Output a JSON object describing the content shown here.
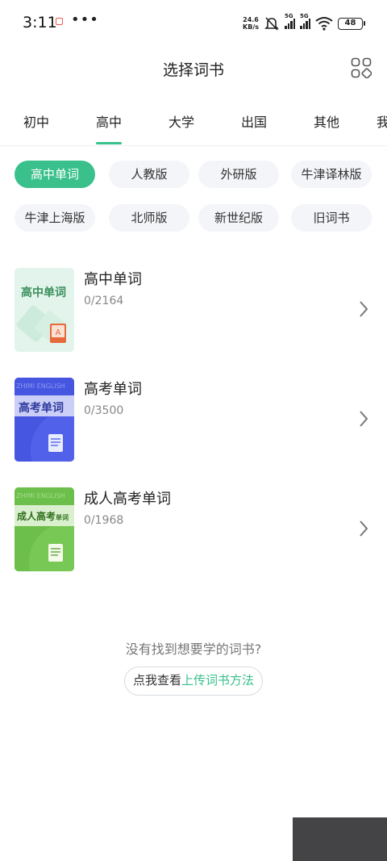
{
  "status_bar": {
    "time": "3:11",
    "dots": "•••",
    "net_speed_value": "24.6",
    "net_speed_unit": "KB/s",
    "sim1_label": "5G",
    "sim2_label": "5G",
    "battery": "48"
  },
  "header": {
    "title": "选择词书",
    "menu_icon": "grid-icon"
  },
  "tabs": [
    {
      "label": "初中",
      "active": false
    },
    {
      "label": "高中",
      "active": true
    },
    {
      "label": "大学",
      "active": false
    },
    {
      "label": "出国",
      "active": false
    },
    {
      "label": "其他",
      "active": false
    },
    {
      "label": "我",
      "active": false
    }
  ],
  "chips": [
    {
      "label": "高中单词",
      "active": true
    },
    {
      "label": "人教版",
      "active": false
    },
    {
      "label": "外研版",
      "active": false
    },
    {
      "label": "牛津译林版",
      "active": false
    },
    {
      "label": "牛津上海版",
      "active": false
    },
    {
      "label": "北师版",
      "active": false
    },
    {
      "label": "新世纪版",
      "active": false
    },
    {
      "label": "旧词书",
      "active": false
    }
  ],
  "books": [
    {
      "name": "高中单词",
      "count": "0/2164",
      "cover_title": "高中单词",
      "cover_color": "#dff3ea"
    },
    {
      "name": "高考单词",
      "count": "0/3500",
      "cover_title": "高考单词",
      "cover_color": "#4656e0",
      "cover_watermark": "ZHIMI ENGLISH"
    },
    {
      "name": "成人高考单词",
      "count": "0/1968",
      "cover_title": "成人高考",
      "cover_title_small": "单词",
      "cover_color": "#6cbf4a",
      "cover_watermark": "ZHIMI ENGLISH"
    }
  ],
  "footer": {
    "not_found": "没有找到想要学的词书?",
    "upload_prefix": "点我查看",
    "upload_link": "上传词书方法"
  },
  "colors": {
    "accent": "#39c08b",
    "chip_bg": "#f3f5f8"
  }
}
